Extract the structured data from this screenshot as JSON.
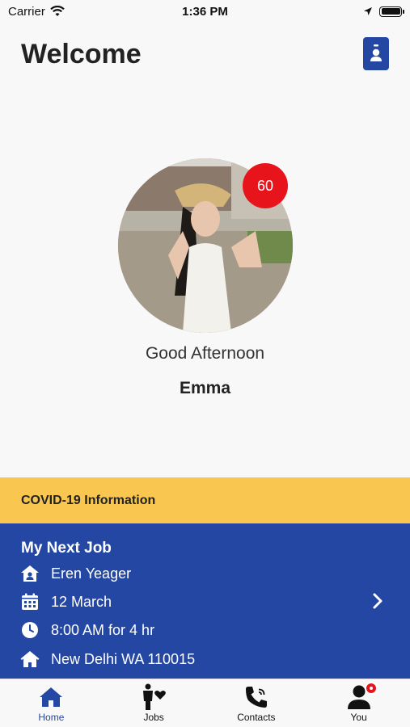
{
  "status_bar": {
    "carrier": "Carrier",
    "time": "1:36 PM"
  },
  "header": {
    "title": "Welcome",
    "badge_icon": "id-badge-icon"
  },
  "profile": {
    "points": "60",
    "greeting": "Good Afternoon",
    "name": "Emma"
  },
  "covid": {
    "label": "COVID-19 Information"
  },
  "next_job": {
    "title": "My Next Job",
    "client": "Eren Yeager",
    "date": "12 March",
    "time": "8:00 AM for 4 hr",
    "address": "New Delhi WA 110015"
  },
  "tabs": [
    {
      "label": "Home",
      "icon": "home-icon",
      "active": true
    },
    {
      "label": "Jobs",
      "icon": "jobs-icon",
      "active": false
    },
    {
      "label": "Contacts",
      "icon": "phone-icon",
      "active": false
    },
    {
      "label": "You",
      "icon": "user-icon",
      "active": false
    }
  ],
  "colors": {
    "brand": "#2447a3",
    "banner": "#f9c74f",
    "badge": "#e8141c"
  }
}
